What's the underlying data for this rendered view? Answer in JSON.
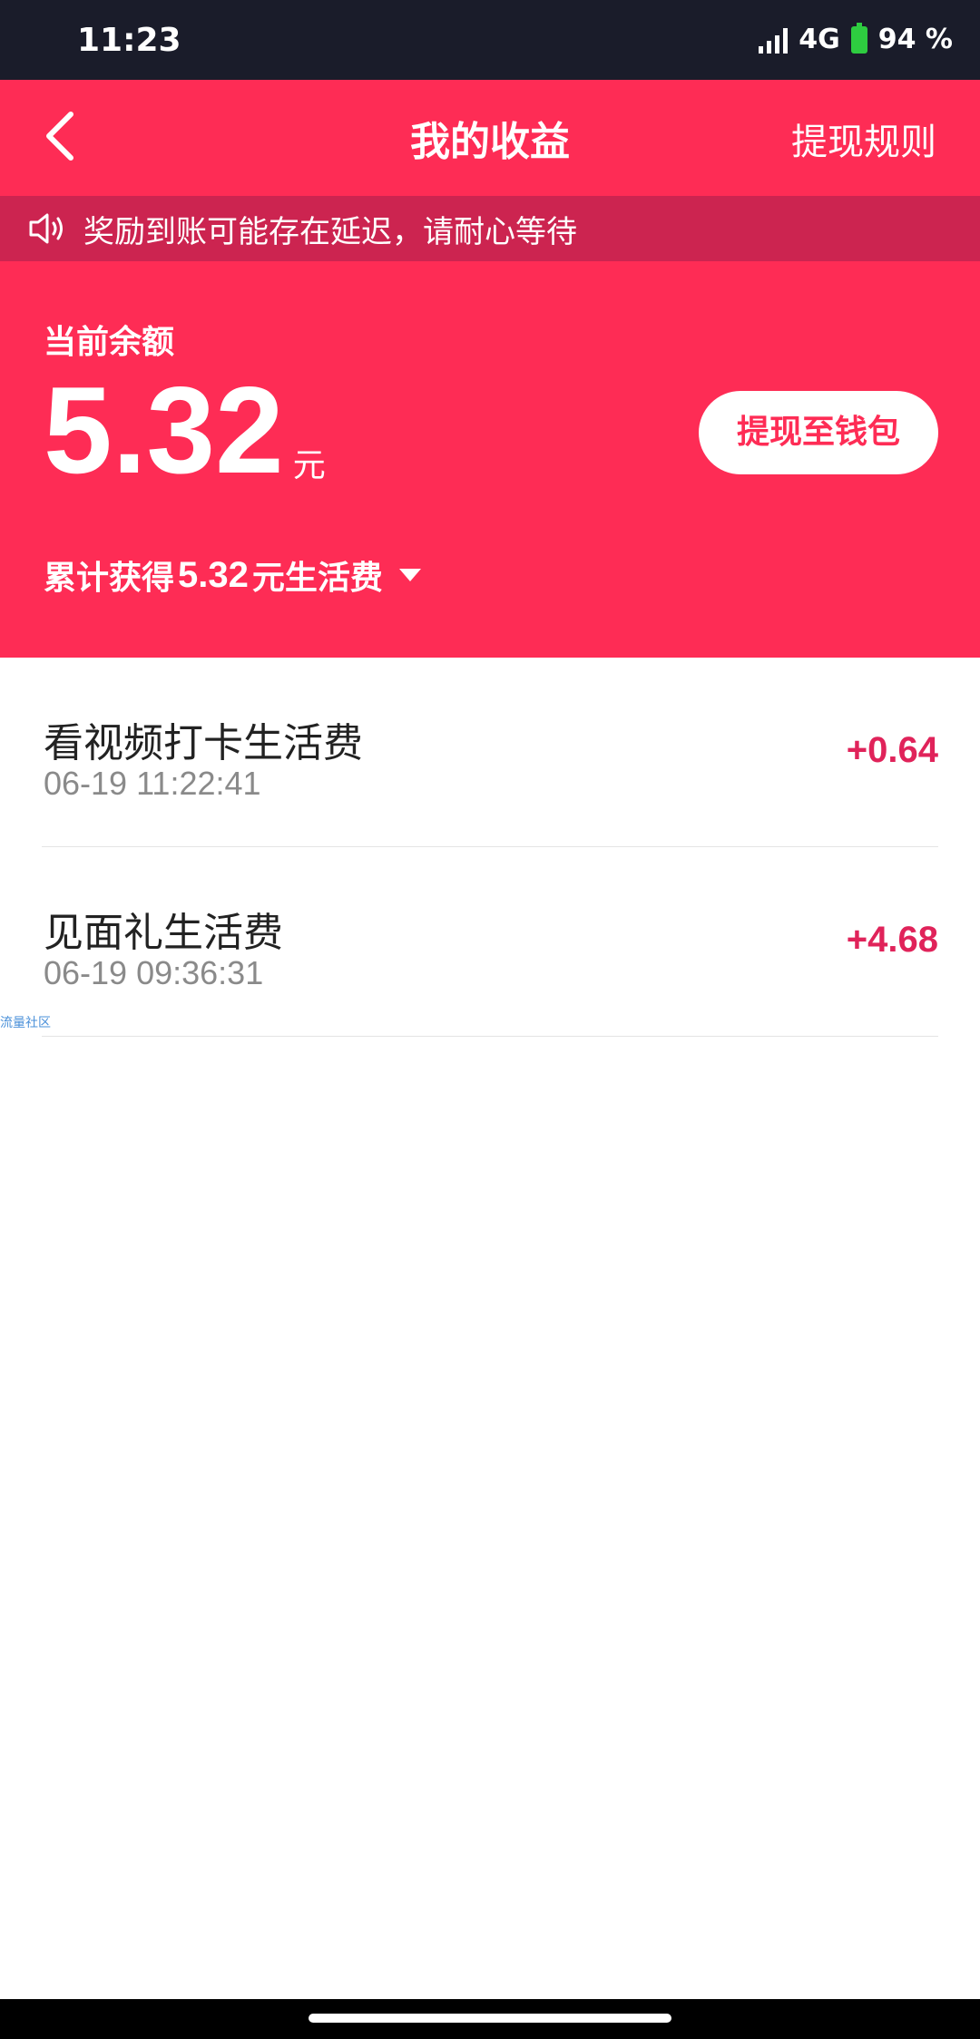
{
  "status_bar": {
    "time": "11:23",
    "network": "4G",
    "battery": "94 %"
  },
  "header": {
    "title": "我的收益",
    "rules_link": "提现规则"
  },
  "notice": {
    "text": "奖励到账可能存在延迟，请耐心等待"
  },
  "balance": {
    "label": "当前余额",
    "amount": "5.32",
    "unit": "元",
    "withdraw_button": "提现至钱包",
    "total_prefix": "累计获得",
    "total_amount": "5.32",
    "total_suffix": "元生活费"
  },
  "records": [
    {
      "title": "看视频打卡生活费",
      "time": "06-19 11:22:41",
      "amount": "+0.64"
    },
    {
      "title": "见面礼生活费",
      "time": "06-19 09:36:31",
      "amount": "+4.68"
    }
  ],
  "watermark": "流量社区",
  "colors": {
    "brand": "#fe2c55",
    "notice_bg": "#cc2450",
    "amount_text": "#e0235a"
  }
}
